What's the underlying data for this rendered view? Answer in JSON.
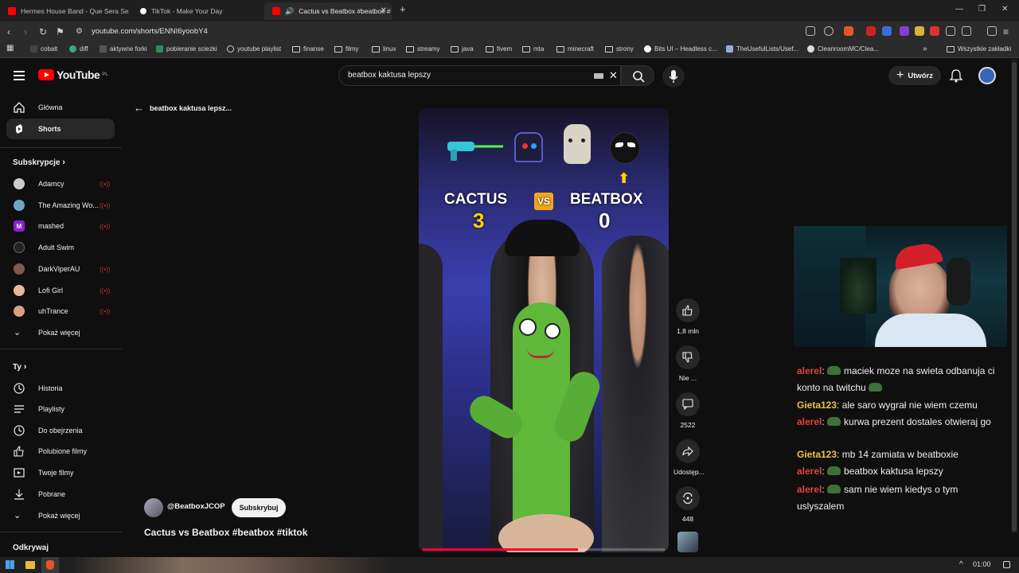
{
  "browser": {
    "tabs": [
      {
        "title": "Hermes House Band - Que Sera Sera",
        "favicon_color": "#ff0000"
      },
      {
        "title": "TikTok - Make Your Day",
        "favicon_color": "#ffffff"
      },
      {
        "title": "Cactus vs Beatbox #beatbox #",
        "favicon_color": "#ff0000"
      }
    ],
    "url": "youtube.com/shorts/ENNI6yoobY4",
    "bookmarks": [
      "cobalt",
      "diff",
      "aktywne forki",
      "pobieranie sciezki",
      "youtube playlist",
      "finanse",
      "filmy",
      "linux",
      "streamy",
      "java",
      "fivem",
      "mta",
      "minecraft",
      "strony",
      "Bits UI – Headless c...",
      "TheUsefulLists/Usef...",
      "CleanroomMC/Clea..."
    ],
    "bookmarks_other": "Wszystkie zakładki"
  },
  "youtube": {
    "logo": "YouTube",
    "region": "PL",
    "search_query": "beatbox kaktusa lepszy",
    "create_label": "Utwórz",
    "sidebar": {
      "home": "Główna",
      "shorts": "Shorts",
      "subscriptions_header": "Subskrypcje",
      "subscriptions": [
        {
          "name": "Adamcy",
          "color": "#cccccc"
        },
        {
          "name": "The Amazing Wo...",
          "color": "#6aa9c9"
        },
        {
          "name": "mashed",
          "color": "#8b1fd6"
        },
        {
          "name": "Adult Swim",
          "color": "#222222"
        },
        {
          "name": "DarkViperAU",
          "color": "#7a5c4a"
        },
        {
          "name": "Lofi Girl",
          "color": "#e6b8a0"
        },
        {
          "name": "uhTrance",
          "color": "#d9a080"
        }
      ],
      "show_more": "Pokaż więcej",
      "you_header": "Ty",
      "you_items": [
        "Historia",
        "Playlisty",
        "Do obejrzenia",
        "Polubione filmy",
        "Twoje filmy",
        "Pobrane",
        "Pokaż więcej"
      ],
      "explore_header": "Odkrywaj"
    },
    "back_label": "beatbox kaktusa lepsz...",
    "short": {
      "left_name": "CACTUS",
      "left_score": "3",
      "vs": "VS",
      "right_name": "BEATBOX",
      "right_score": "0",
      "channel": "@BeatboxJCOP",
      "subscribe": "Subskrybuj",
      "title": "Cactus vs Beatbox #beatbox #tiktok",
      "progress": 0.64
    },
    "actions": {
      "likes": "1,8 mln",
      "dislike": "Nie ...",
      "comments": "2522",
      "share": "Udostęp...",
      "remix": "448"
    }
  },
  "chat": [
    {
      "user": "alerel",
      "user_color": "#e0443c",
      "text": "maciek moze na swieta odbanuja ci konto na twitchu",
      "emote_end": true
    },
    {
      "user": "Gieta123",
      "user_color": "#f0c24a",
      "text": "ale saro wygrał nie wiem czemu"
    },
    {
      "user": "alerel",
      "user_color": "#e0443c",
      "text": "kurwa prezent dostales otwieraj go"
    },
    {
      "user": "Gieta123",
      "user_color": "#f0c24a",
      "text": "mb 14 zamiata w beatboxie"
    },
    {
      "user": "alerel",
      "user_color": "#e0443c",
      "text": "beatbox kaktusa lepszy"
    },
    {
      "user": "alerel",
      "user_color": "#e0443c",
      "text": "sam nie wiem kiedys o tym uslyszalem"
    }
  ],
  "taskbar": {
    "time": "01:00"
  }
}
